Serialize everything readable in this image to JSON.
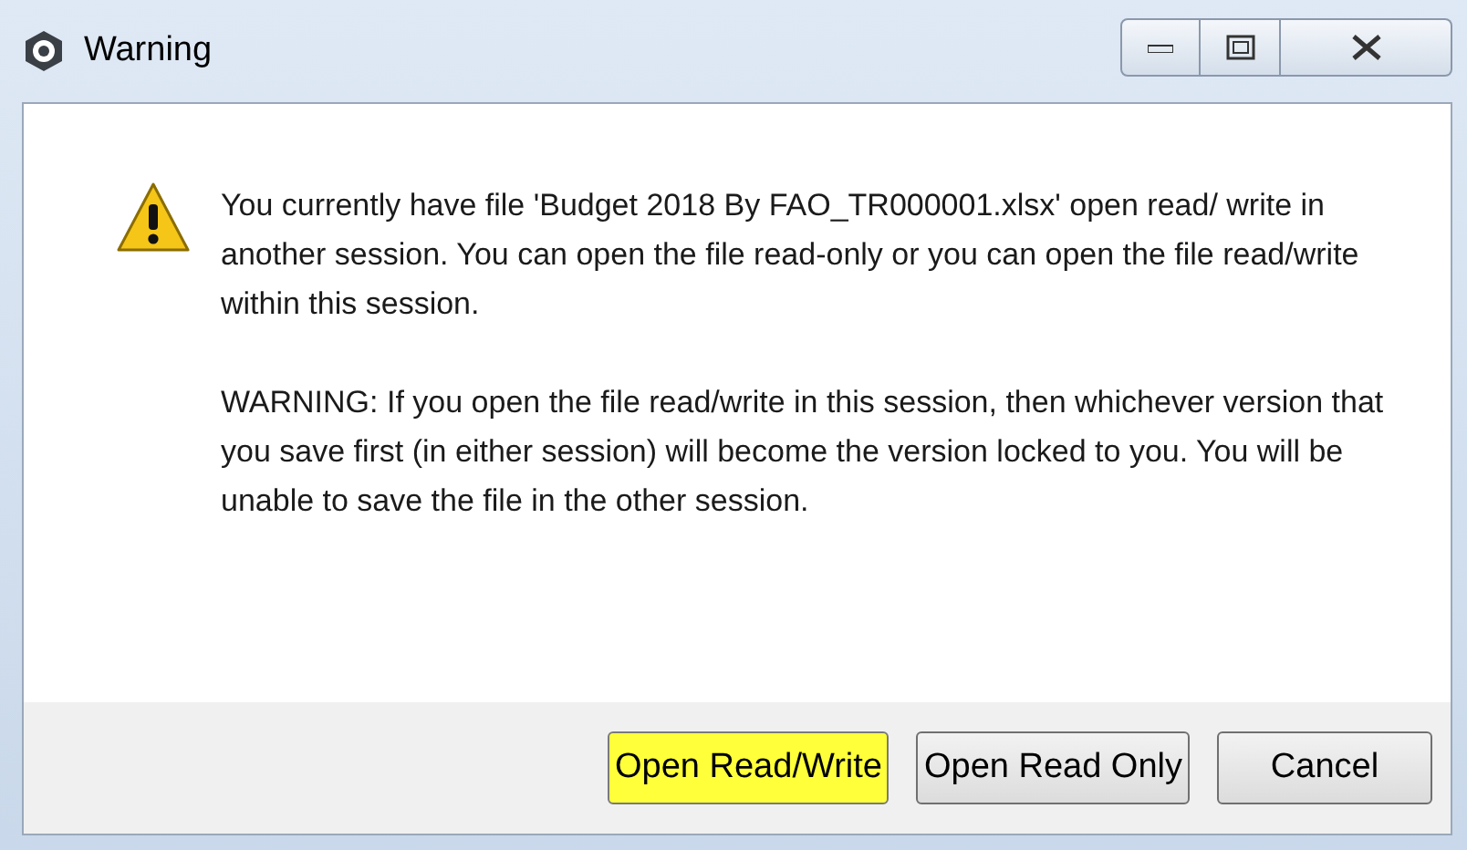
{
  "window": {
    "title": "Warning"
  },
  "message": [
    "You currently have file 'Budget 2018 By FAO_TR000001.xlsx' open read/ write in another session. You can open the file read-only or you can open the file read/write within this session.",
    "WARNING: If you open the file read/write in this session, then whichever version that you save first (in either session) will become the version locked to you. You will be unable to save the file in the other session."
  ],
  "buttons": [
    {
      "label": "Open Read/Write",
      "highlighted": true
    },
    {
      "label": "Open Read Only",
      "highlighted": false
    },
    {
      "label": "Cancel",
      "highlighted": false
    }
  ]
}
